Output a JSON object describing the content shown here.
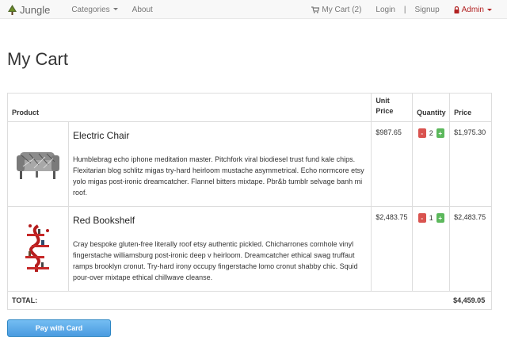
{
  "navbar": {
    "brand": "Jungle",
    "categories_label": "Categories",
    "about_label": "About",
    "cart_label": "My Cart (2)",
    "login_label": "Login",
    "separator": "|",
    "signup_label": "Signup",
    "admin_label": "Admin"
  },
  "page_title": "My Cart",
  "table": {
    "headers": {
      "product": "Product",
      "unit_price": "Unit Price",
      "quantity": "Quantity",
      "price": "Price"
    },
    "items": [
      {
        "name": "Electric Chair",
        "description": "Humblebrag echo iphone meditation master. Pitchfork viral biodiesel trust fund kale chips. Flexitarian blog schlitz migas try-hard heirloom mustache asymmetrical. Echo normcore etsy yolo migas post-ironic dreamcatcher. Flannel bitters mixtape. Pbr&b tumblr selvage banh mi roof.",
        "unit_price": "$987.65",
        "quantity": "2",
        "price": "$1,975.30",
        "minus": "-",
        "plus": "+"
      },
      {
        "name": "Red Bookshelf",
        "description": "Cray bespoke gluten-free literally roof etsy authentic pickled. Chicharrones cornhole vinyl fingerstache williamsburg post-ironic deep v heirloom. Dreamcatcher ethical swag truffaut ramps brooklyn cronut. Try-hard irony occupy fingerstache lomo cronut shabby chic. Squid pour-over mixtape ethical chillwave cleanse.",
        "unit_price": "$2,483.75",
        "quantity": "1",
        "price": "$2,483.75",
        "minus": "-",
        "plus": "+"
      }
    ],
    "total_label": "TOTAL:",
    "total_value": "$4,459.05"
  },
  "pay_button": "Pay with Card",
  "icons": {
    "brand": "tree-icon",
    "cart": "shopping-cart-icon",
    "admin": "lock-icon"
  },
  "colors": {
    "minus_button": "#d9534f",
    "plus_button": "#5cb85c",
    "pay_button": "#4a9be0",
    "admin_link": "#b22222"
  }
}
